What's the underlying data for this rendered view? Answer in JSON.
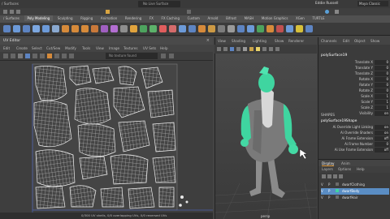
{
  "top_menu": {
    "items": [
      "/ Surfaces",
      "Poly Modeling",
      "Sculpting",
      "Rigging",
      "Animation",
      "Rendering",
      "FX",
      "FX Caching",
      "Custom",
      "Arnold",
      "Bifrost",
      "MASH",
      "Motion Graphics",
      "XGen",
      "TURTLE"
    ],
    "user": "Eddie Russell",
    "workspace": "Maya Classic",
    "live_surface": "No Live Surface"
  },
  "uv_editor": {
    "title": "UV Editor",
    "menu": [
      "Edit",
      "Create",
      "Select",
      "Cut/Sew",
      "Modify",
      "Tools",
      "View",
      "Image",
      "Textures",
      "UV Sets",
      "Help"
    ],
    "texture_field": "No texture found",
    "status": "0/300 UV shells, 0/0 overlapping UVs, 0/0 reversed UVs"
  },
  "viewport": {
    "menu": [
      "View",
      "Shading",
      "Lighting",
      "Show",
      "Renderer",
      "Panels"
    ],
    "camera_label": "persp"
  },
  "channel_box": {
    "menu": [
      "Channels",
      "Edit",
      "Object",
      "Show"
    ],
    "object_name": "polySurface19",
    "attributes": [
      {
        "label": "Translate X",
        "value": "0"
      },
      {
        "label": "Translate Y",
        "value": "0"
      },
      {
        "label": "Translate Z",
        "value": "0"
      },
      {
        "label": "Rotate X",
        "value": "0"
      },
      {
        "label": "Rotate Y",
        "value": "0"
      },
      {
        "label": "Rotate Z",
        "value": "0"
      },
      {
        "label": "Scale X",
        "value": "1"
      },
      {
        "label": "Scale Y",
        "value": "1"
      },
      {
        "label": "Scale Z",
        "value": "1"
      },
      {
        "label": "Visibility",
        "value": "on"
      }
    ],
    "shapes_heading": "SHAPES",
    "shape_name": "polySurface19Shape",
    "shape_attributes": [
      {
        "label": "Ai Override Light Linking",
        "value": "on"
      },
      {
        "label": "Ai Override Shaders",
        "value": "on"
      },
      {
        "label": "Ai Frame Extension",
        "value": "off"
      },
      {
        "label": "Ai Frame Number",
        "value": "0"
      },
      {
        "label": "Ai Use Frame Extension",
        "value": "off"
      }
    ]
  },
  "layers": {
    "tabs": [
      "Display",
      "Anim"
    ],
    "menu": [
      "Layers",
      "Options",
      "Help"
    ],
    "rows": [
      {
        "v": "V",
        "p": "P",
        "name": "dwarfClothing",
        "selected": false
      },
      {
        "v": "V",
        "p": "P",
        "name": "dwarfBody",
        "selected": true
      },
      {
        "v": "V",
        "p": "P",
        "name": "dwarfHair",
        "selected": false
      }
    ]
  },
  "colors": {
    "accent": "#e39c3c",
    "selected_highlight": "#5a8dc4",
    "uv_bg": "#3e3e3e",
    "character_green": "#3fd5a0"
  }
}
